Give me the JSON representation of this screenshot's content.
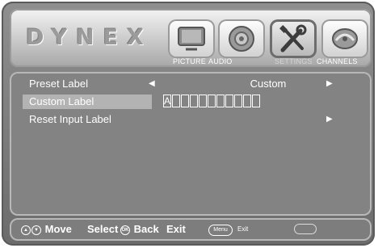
{
  "header": {
    "brand": "DYNEX",
    "tabs": [
      {
        "id": "picture",
        "label": "PICTURE",
        "icon": "tv-icon"
      },
      {
        "id": "audio",
        "label": "AUDIO",
        "icon": "speaker-icon"
      },
      {
        "id": "settings",
        "label": "SETTINGS",
        "icon": "wrench-screwdriver-icon",
        "active": true
      },
      {
        "id": "channels",
        "label": "CHANNELS",
        "icon": "satellite-dish-icon"
      }
    ]
  },
  "menu": {
    "rows": [
      {
        "label": "Preset Label",
        "value": "Custom"
      },
      {
        "label": "Custom Label",
        "chars": [
          "A",
          "",
          "",
          "",
          "",
          "",
          "",
          "",
          "",
          "",
          ""
        ]
      },
      {
        "label": "Reset Input Label"
      }
    ]
  },
  "footer": {
    "move": "Move",
    "select": "Select",
    "back": "Back",
    "exit": "Exit",
    "menu_badge": "Menu",
    "exit_small": "Exit",
    "colors": {
      "text": "#ffffff",
      "panel": "#838383"
    }
  }
}
